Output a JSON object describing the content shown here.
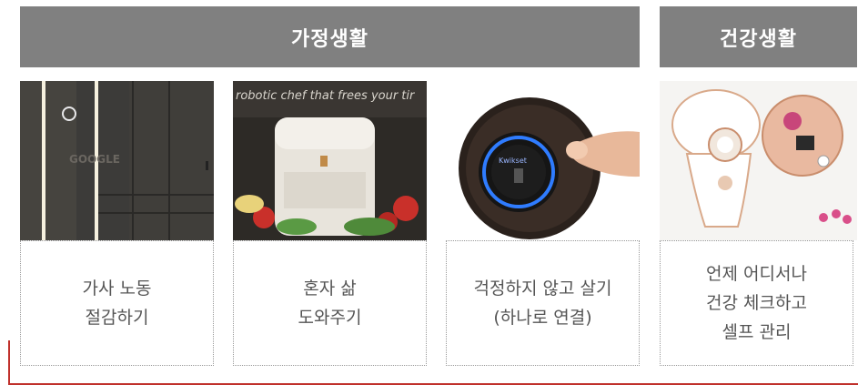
{
  "headers": {
    "home_life": "가정생활",
    "health_life": "건강생활"
  },
  "images": {
    "photo1_watermark": "GOOGLE",
    "photo2_banner": "robotic chef that frees your tir",
    "photo3_brand": "Kwikset"
  },
  "cards": [
    {
      "line1": "가사 노동",
      "line2": "절감하기"
    },
    {
      "line1": "혼자 삶",
      "line2": "도와주기"
    },
    {
      "line1": "걱정하지 않고 살기",
      "line2": "(하나로 연결)"
    },
    {
      "line1": "언제 어디서나",
      "line2": "건강 체크하고",
      "line3": "셀프 관리"
    }
  ],
  "colors": {
    "header_bg": "#808080",
    "accent_red": "#c0302b"
  }
}
